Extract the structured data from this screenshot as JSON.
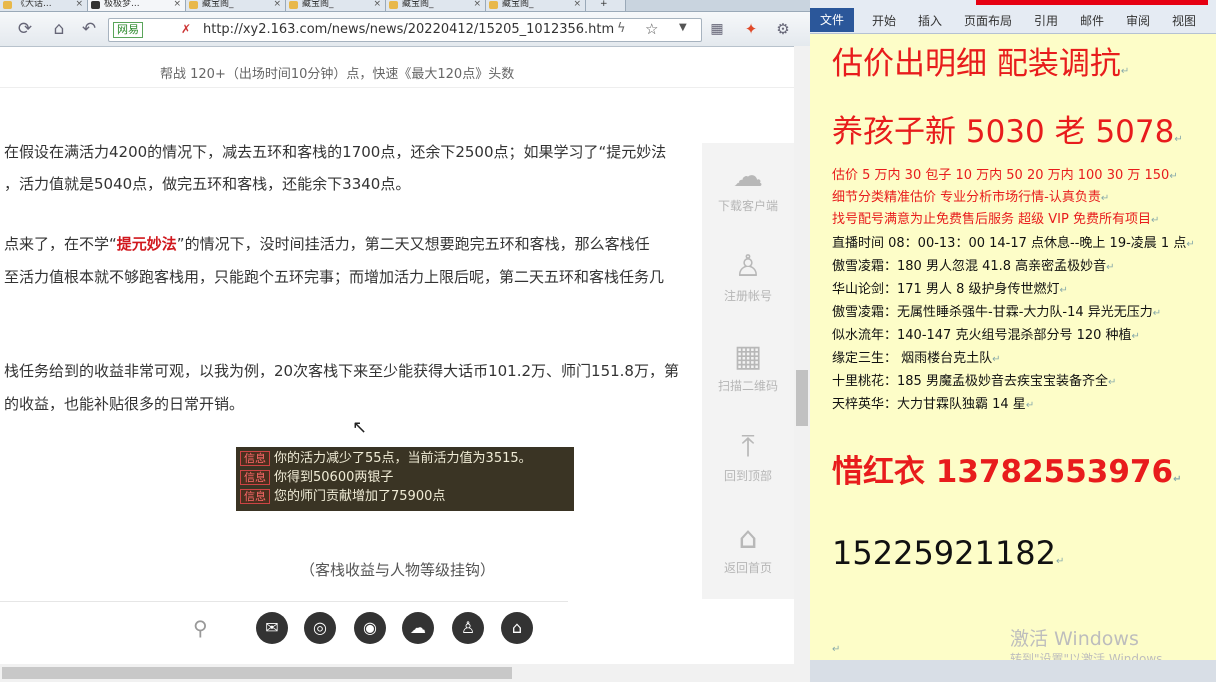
{
  "browser": {
    "tabs": [
      {
        "label": "《大话..."
      },
      {
        "label": "极极梦..."
      },
      {
        "label": "藏宝阁_"
      },
      {
        "label": "藏宝阁_"
      },
      {
        "label": "藏宝阁_"
      },
      {
        "label": "藏宝阁_"
      }
    ],
    "site_badge": "网易",
    "url": "http://xy2.163.com/news/news/20220412/15205_1012356.htm",
    "top_fragment": "帮战                              120+（出场时间10分钟）点，快速《最大120点》头数",
    "paragraphs": [
      {
        "segments": [
          {
            "t": "在假设在满活力4200的情况下，减去五环和客栈的1700点，还余下2500点；如果学习了“提元妙法",
            "hl": false
          }
        ]
      },
      {
        "segments": [
          {
            "t": "，活力值就是5040点，做完五环和客栈，还能余下3340点。",
            "hl": false
          }
        ]
      },
      {
        "segments": [
          {
            "t": "点来了，在不学“",
            "hl": false
          },
          {
            "t": "提元妙法",
            "hl": true
          },
          {
            "t": "”的情况下，没时间挂活力，第二天又想要跑完五环和客栈，那么客栈任",
            "hl": false
          }
        ]
      },
      {
        "segments": [
          {
            "t": "至活力值根本就不够跑客栈用，只能跑个五环完事；而增加活力上限后呢，第二天五环和客栈任务几",
            "hl": false
          }
        ]
      },
      {
        "segments": [
          {
            "t": "栈任务给到的收益非常可观，以我为例，20次客栈下来至少能获得大话币101.2万、师门151.8万，第",
            "hl": false
          }
        ]
      },
      {
        "segments": [
          {
            "t": "的收益，也能补贴很多的日常开销。",
            "hl": false
          }
        ]
      }
    ],
    "game_messages": [
      {
        "tag": "信息",
        "text": "你的活力减少了55点，当前活力值为3515。"
      },
      {
        "tag": "信息",
        "text": "你得到50600两银子"
      },
      {
        "tag": "信息",
        "text": "您的师门贡献增加了75900点"
      }
    ],
    "caption": "（客栈收益与人物等级挂钩）",
    "side_panel": [
      {
        "icon": "download-cloud-icon",
        "label": "下载客户端"
      },
      {
        "icon": "user-add-icon",
        "label": "注册帐号"
      },
      {
        "icon": "qrcode-icon",
        "label": "扫描二维码"
      },
      {
        "icon": "back-to-top-icon",
        "label": "回到顶部"
      },
      {
        "icon": "home-icon",
        "label": "返回首页"
      }
    ],
    "social_icons": [
      "wechat-icon",
      "qq-icon",
      "weibo-icon",
      "cloud-icon",
      "user-icon",
      "home-icon"
    ]
  },
  "word": {
    "file_tab": "文件",
    "ribbon_tabs": [
      "开始",
      "插入",
      "页面布局",
      "引用",
      "邮件",
      "审阅",
      "视图"
    ],
    "lines": {
      "l1": "估价出明细 配装调抗",
      "l2": "养孩子新 5030 老 5078",
      "l3": "估价 5 万内 30 包子  10 万内 50  20 万内 100  30 万 150",
      "l4": "细节分类精准估价  专业分析市场行情-认真负责",
      "l5": "找号配号满意为止免费售后服务   超级 VIP 免费所有项目",
      "l6": "直播时间 08：00-13：00  14-17 点休息--晚上 19-凌晨 1 点",
      "l7": "傲雪凌霜：180 男人忽混 41.8 高亲密孟极妙音",
      "l8": "华山论剑：171 男人 8 级护身传世燃灯",
      "l9": "傲雪凌霜：无属性睡杀强牛-甘霖-大力队-14 异光无压力",
      "l10": "似水流年：140-147 克火组号混杀部分号 120 种植",
      "l11": "缘定三生：  烟雨楼台克土队",
      "l12": "十里桃花：185 男魔孟极妙音去疾宝宝装备齐全",
      "l13": "天梓英华：大力甘霖队独霸 14 星",
      "l14": "惜红衣 13782553976",
      "l15": "15225921182"
    },
    "watermark_title": "激活 Windows",
    "watermark_sub": "转到\"设置\"以激活 Windows。"
  },
  "colors": {
    "accent_red": "#e81c1c",
    "doc_background": "#fdfdc8",
    "word_blue": "#2b579a"
  }
}
